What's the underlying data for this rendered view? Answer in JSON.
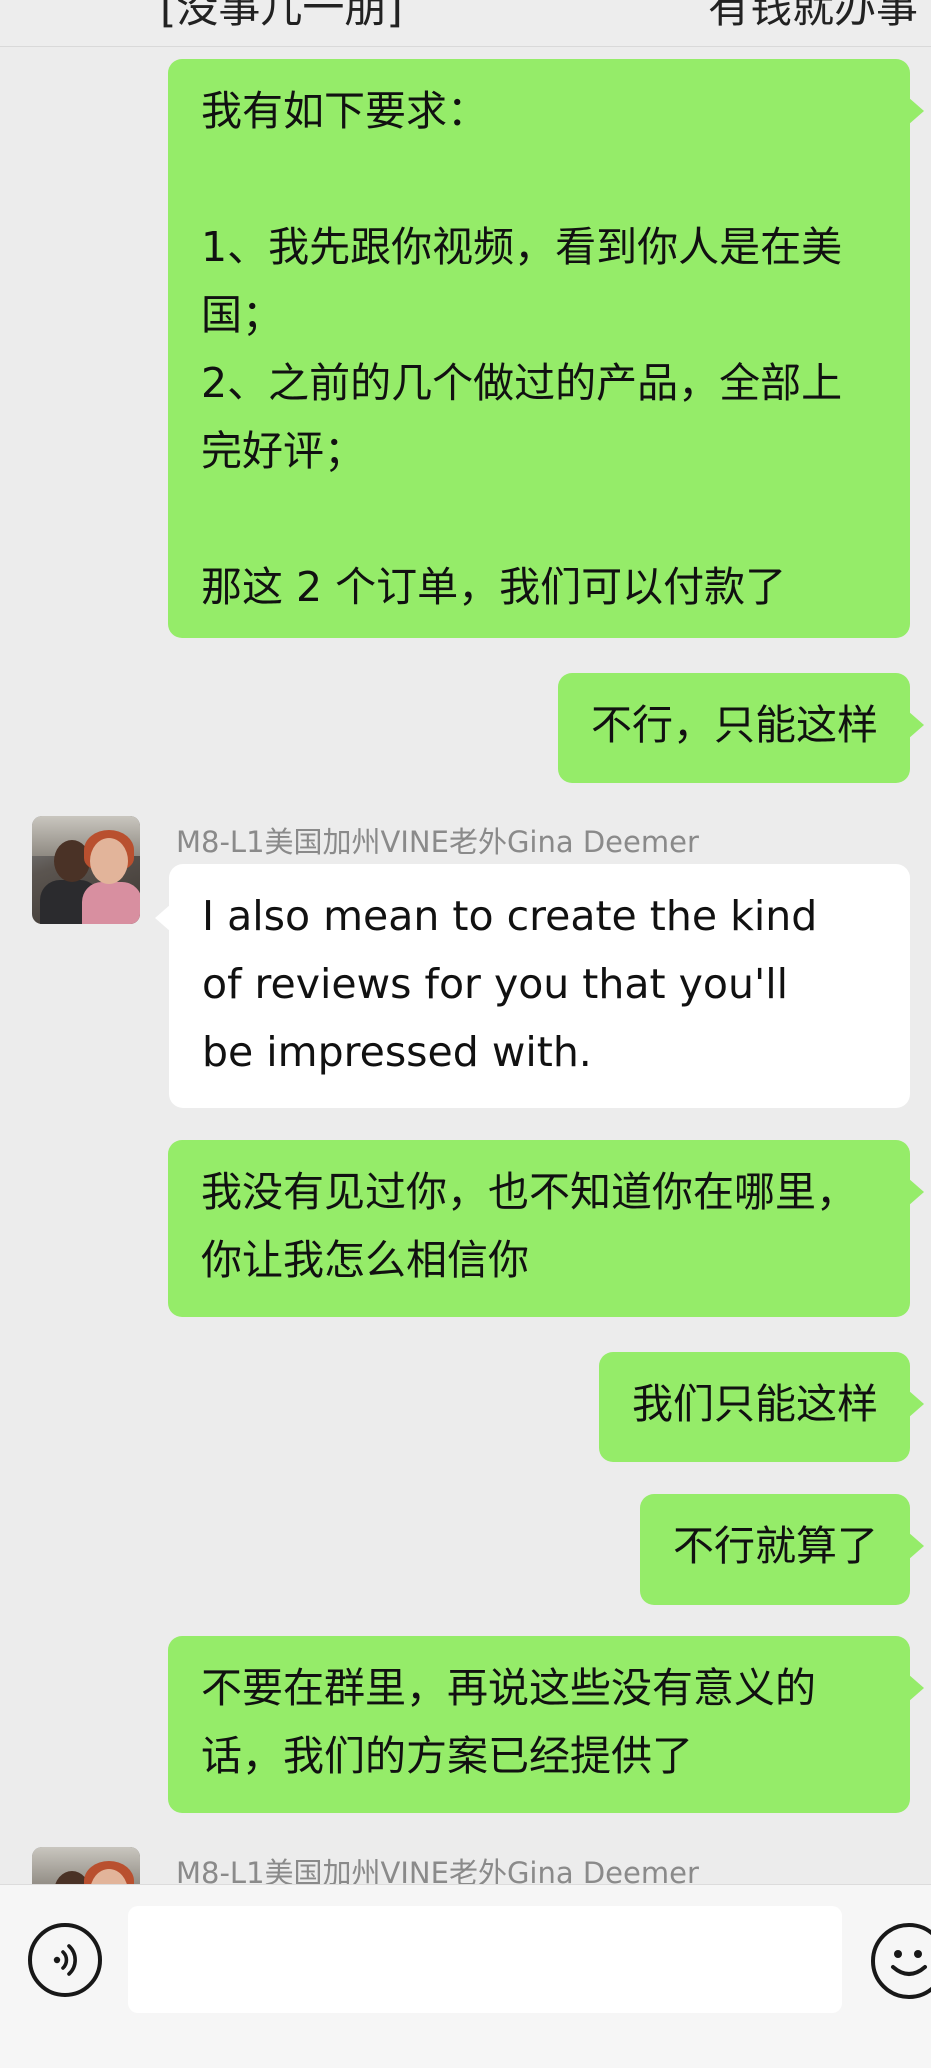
{
  "header": {
    "cut_text_left": "[没事儿一朋]",
    "cut_text_right": "有钱就办事"
  },
  "messages": [
    {
      "direction": "sent",
      "lines": [
        "我有如下要求：",
        "",
        "1、我先跟你视频，看到你人是在美",
        "国；",
        "2、之前的几个做过的产品，全部上",
        "完好评；",
        "",
        "那这 2 个订单，我们可以付款了"
      ]
    },
    {
      "direction": "sent",
      "lines": [
        "不行，只能这样"
      ]
    },
    {
      "direction": "received",
      "sender": "M8-L1美国加州VINE老外Gina Deemer",
      "lines": [
        "I also mean to create the kind",
        "of reviews for you that you'll",
        "be impressed with."
      ]
    },
    {
      "direction": "sent",
      "lines": [
        "我没有见过你，也不知道你在哪里，",
        "你让我怎么相信你"
      ]
    },
    {
      "direction": "sent",
      "lines": [
        "我们只能这样"
      ]
    },
    {
      "direction": "sent",
      "lines": [
        "不行就算了"
      ]
    },
    {
      "direction": "sent",
      "lines": [
        "不要在群里，再说这些没有意义的",
        "话，我们的方案已经提供了"
      ]
    },
    {
      "direction": "received",
      "sender": "M8-L1美国加州VINE老外Gina Deemer",
      "lines": []
    }
  ],
  "input_bar": {
    "value": "",
    "voice_icon": "voice-icon",
    "emoji_icon": "emoji-icon"
  },
  "colors": {
    "sent_bubble": "#95ec69",
    "received_bubble": "#ffffff",
    "chat_background": "#ececec"
  }
}
